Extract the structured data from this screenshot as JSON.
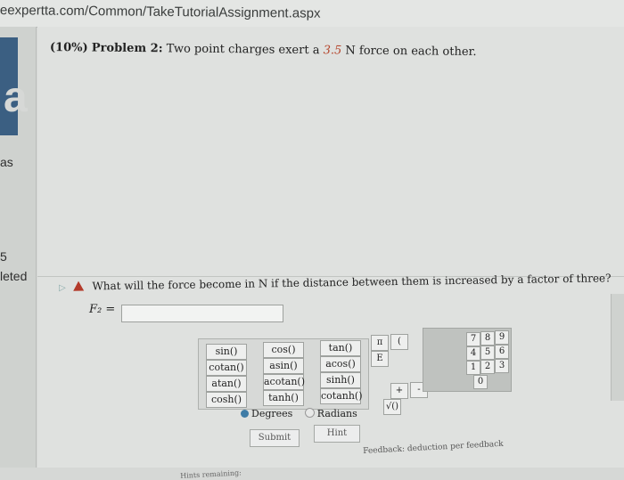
{
  "url": "eexpertta.com/Common/TakeTutorialAssignment.aspx",
  "sidebar": {
    "logo_letter": "a",
    "texts": [
      "as",
      "5",
      "leted"
    ]
  },
  "problem": {
    "percent": "(10%)",
    "label": "Problem 2:",
    "text_before": "Two point charges exert a",
    "force_value": "3.5",
    "text_after": "N force on each other."
  },
  "question": {
    "text": "What will the force become in N if the distance between them is increased by a factor of three?",
    "answer_label": "F₂ =",
    "answer_value": ""
  },
  "calculator": {
    "functions": [
      "sin()",
      "cos()",
      "tan()",
      "cotan()",
      "asin()",
      "acos()",
      "atan()",
      "acotan()",
      "sinh()",
      "cosh()",
      "tanh()",
      "cotanh()"
    ],
    "symbols": [
      "π",
      "(",
      "E",
      "+",
      "-",
      "√()"
    ],
    "digits": [
      "7",
      "8",
      "9",
      "4",
      "5",
      "6",
      "1",
      "2",
      "3",
      "0"
    ],
    "degrees_label": "Degrees",
    "radians_label": "Radians"
  },
  "actions": {
    "submit": "Submit",
    "hint": "Hint",
    "feedback_label": "Feedback:",
    "feedback_note": "deduction per feedback",
    "hints_remaining": "Hints remaining:"
  }
}
